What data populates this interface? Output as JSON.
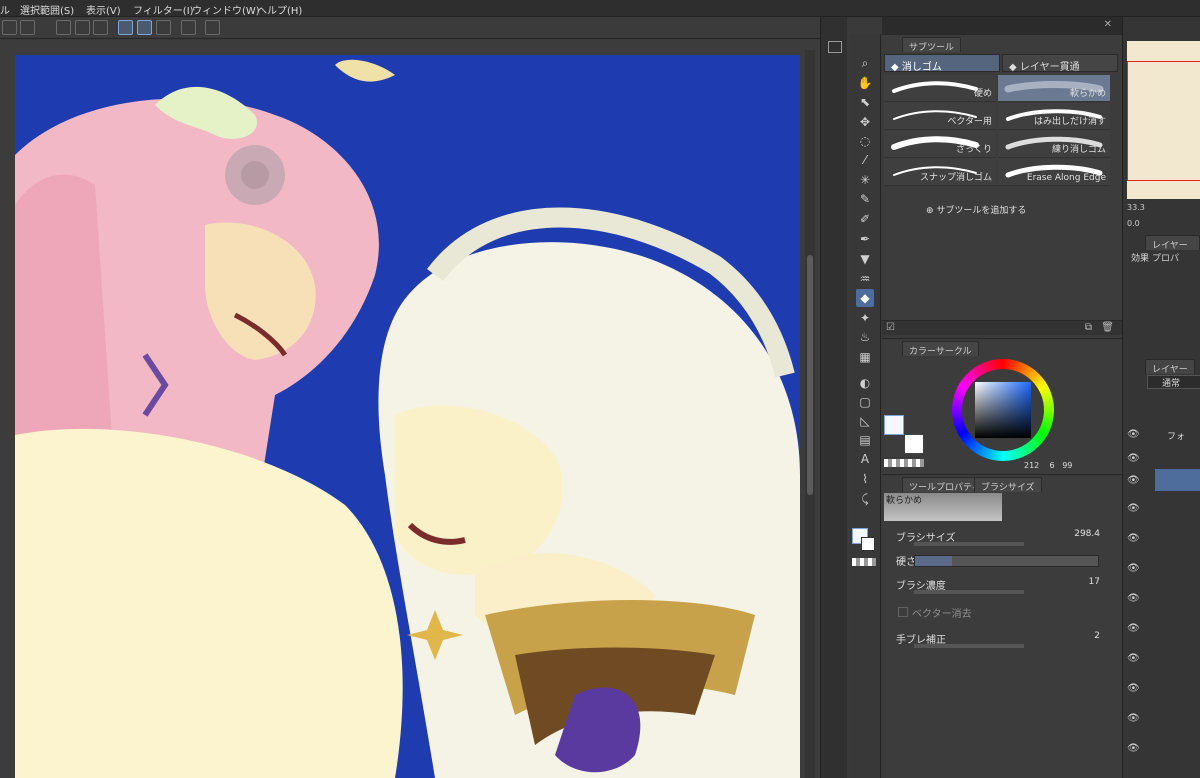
{
  "menu": {
    "items": [
      "ル",
      "選択範囲(S)",
      "表示(V)",
      "フィルター(I)",
      "ウィンドウ(W)",
      "ヘルプ(H)"
    ]
  },
  "subtool_panel": {
    "tab_label": "サブツール",
    "group_eraser": "消しゴム",
    "group_layer_through": "レイヤー貫通",
    "brushes": [
      {
        "label": "硬め",
        "selected": false
      },
      {
        "label": "軟らかめ",
        "selected": true
      },
      {
        "label": "ベクター用",
        "selected": false
      },
      {
        "label": "はみ出しだけ消す",
        "selected": false
      },
      {
        "label": "ざっくり",
        "selected": false
      },
      {
        "label": "練り消しゴム",
        "selected": false
      },
      {
        "label": "スナップ消しゴム",
        "selected": false
      },
      {
        "label": "Erase Along Edge",
        "selected": false
      }
    ],
    "add_subtool": "サブツールを追加する"
  },
  "color_panel": {
    "tab_label": "カラーサークル",
    "h": "212",
    "s": "6",
    "v": "99",
    "current_color": "#f4f7fe"
  },
  "tool_property": {
    "tab_label": "ツールプロパティ",
    "tab2_label": "ブラシサイズ",
    "preset_name": "軟らかめ",
    "brush_size_label": "ブラシサイズ",
    "brush_size_value": "298.4",
    "hardness_label": "硬さ",
    "density_label": "ブラシ濃度",
    "density_value": "17",
    "vector_erase_label": "ベクター消去",
    "stabilization_label": "手ブレ補正",
    "stabilization_value": "2"
  },
  "navigator": {
    "zoom": "33.3",
    "rotation": "0.0"
  },
  "layer_property": {
    "tab_label": "レイヤープロパ",
    "effect_label": "効果"
  },
  "layer_panel": {
    "tab_label": "レイヤー",
    "blend_mode": "通常",
    "folder_label": "フォ"
  },
  "colors": {
    "accent_select": "#4e6c9c",
    "canvas_bg": "#1f3bb0"
  }
}
